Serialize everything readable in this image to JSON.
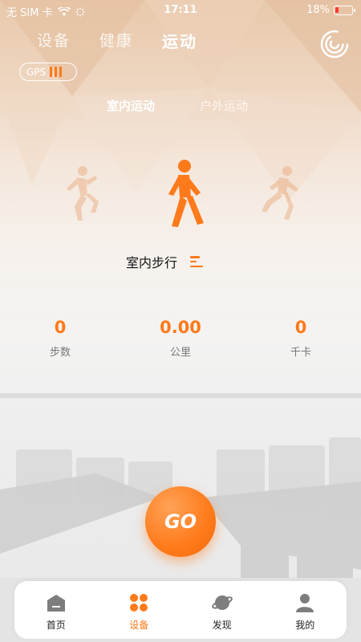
{
  "status_bar": {
    "carrier": "无 SIM 卡",
    "time": "17:11",
    "battery": "18%"
  },
  "top_tabs": [
    {
      "label": "设备"
    },
    {
      "label": "健康"
    },
    {
      "label": "运动",
      "active": true
    }
  ],
  "gps": {
    "label": "GPS"
  },
  "sub_tabs": [
    {
      "label": "室内运动",
      "active": true
    },
    {
      "label": "户外运动"
    }
  ],
  "mode": {
    "label": "室内步行"
  },
  "stats": [
    {
      "value": "0",
      "unit": "步数"
    },
    {
      "value": "0.00",
      "unit": "公里"
    },
    {
      "value": "0",
      "unit": "千卡"
    }
  ],
  "go_button": {
    "label": "GO"
  },
  "tabbar": [
    {
      "label": "首页",
      "icon": "home-icon"
    },
    {
      "label": "设备",
      "icon": "device-icon",
      "active": true
    },
    {
      "label": "发现",
      "icon": "planet-icon"
    },
    {
      "label": "我的",
      "icon": "profile-icon"
    }
  ],
  "colors": {
    "accent": "#ff7a1a",
    "header_bg": "#e8c9ab"
  }
}
